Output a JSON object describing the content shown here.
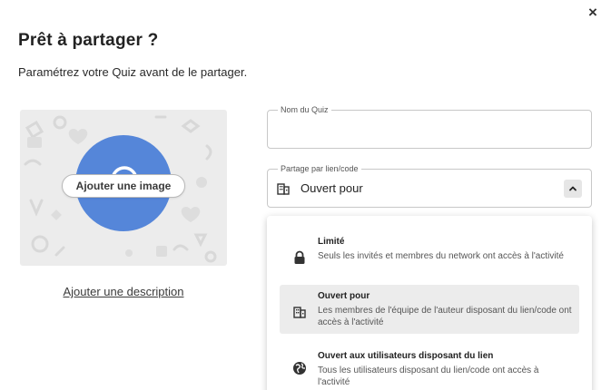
{
  "dialog": {
    "close_glyph": "×",
    "title": "Prêt à partager ?",
    "subtitle": "Paramétrez votre Quiz avant de le partager."
  },
  "image": {
    "add_image_label": "Ajouter une image",
    "add_description_label": "Ajouter une description",
    "accent_color": "#5586d9",
    "icon": "chat-bubble-icon"
  },
  "fields": {
    "name": {
      "legend": "Nom du Quiz",
      "value": ""
    },
    "share": {
      "legend": "Partage par lien/code",
      "value": "Ouvert pour",
      "icon": "building-icon"
    }
  },
  "share_options": [
    {
      "title": "Limité",
      "description": "Seuls les invités et membres du network ont accès à l'activité",
      "icon": "lock-icon",
      "selected": false
    },
    {
      "title": "Ouvert pour",
      "description": "Les membres de l'équipe de l'auteur disposant du lien/code ont accès à l'activité",
      "icon": "building-icon",
      "selected": true
    },
    {
      "title": "Ouvert aux utilisateurs disposant du lien",
      "description": "Tous les utilisateurs disposant du lien/code ont accès à l'activité",
      "icon": "globe-icon",
      "selected": false
    }
  ]
}
